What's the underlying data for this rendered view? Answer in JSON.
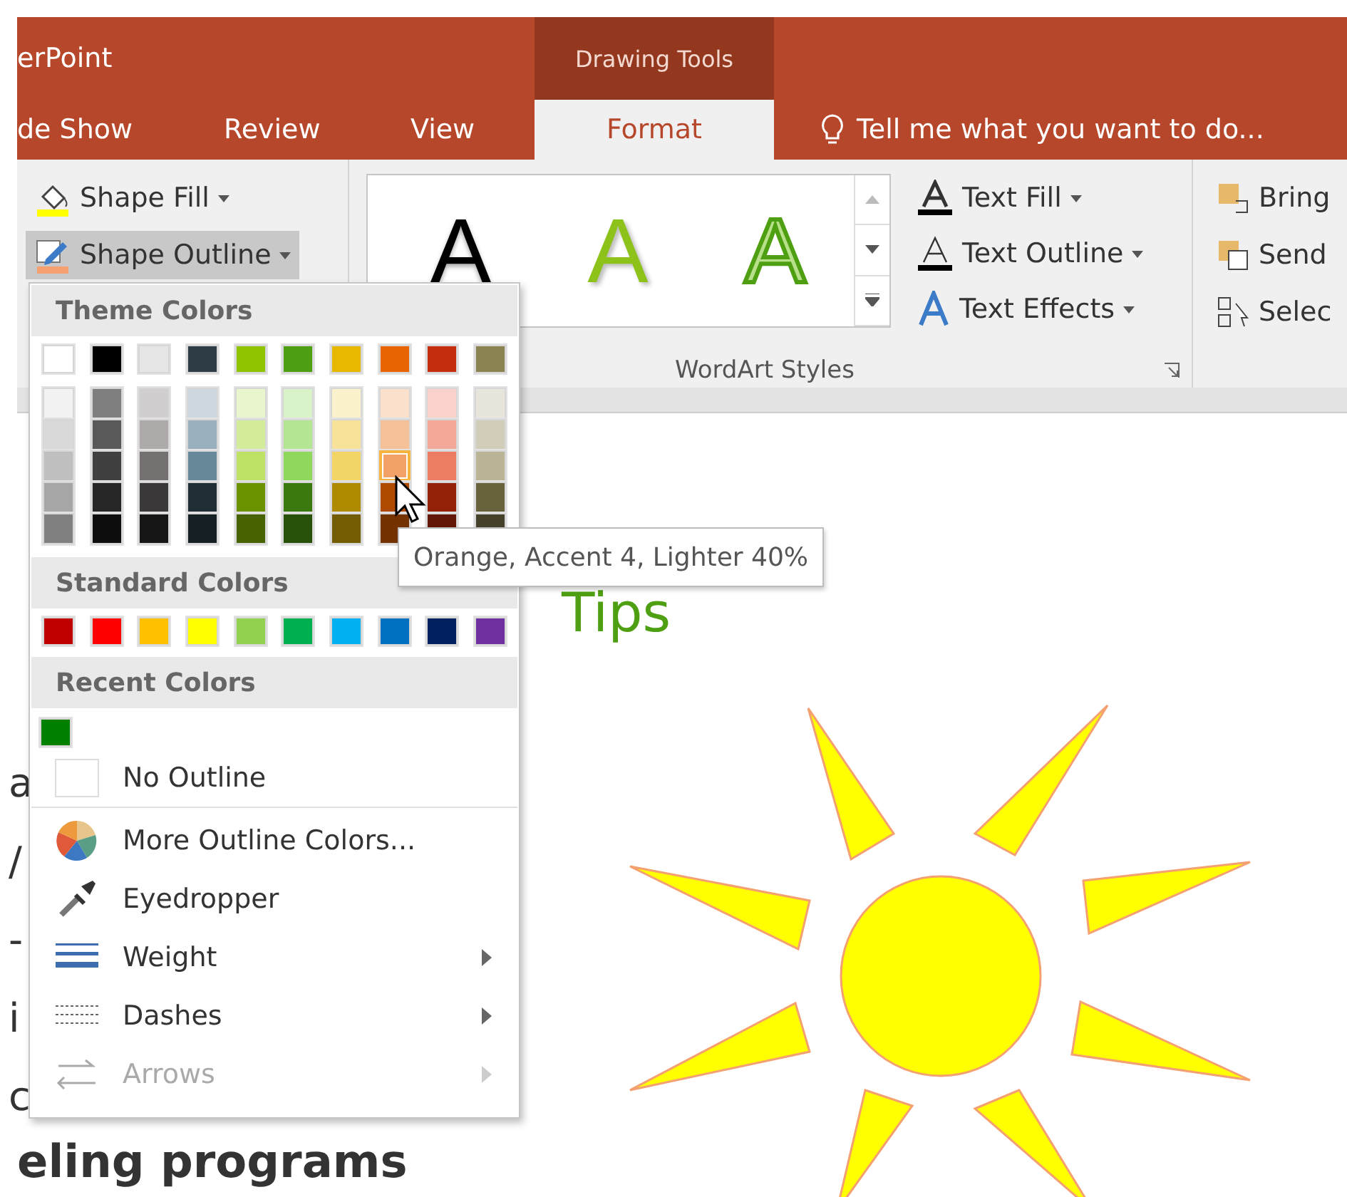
{
  "window": {
    "title": "erPoint",
    "context_tab": "Drawing Tools"
  },
  "tabs": [
    {
      "label": "de Show",
      "selected": false
    },
    {
      "label": "Review",
      "selected": false
    },
    {
      "label": "View",
      "selected": false
    },
    {
      "label": "Format",
      "selected": true
    }
  ],
  "tell_me": {
    "placeholder": "Tell me what you want to do..."
  },
  "ribbon": {
    "shape_buttons": [
      {
        "kind": "fill",
        "label": "Shape Fill",
        "selected": false
      },
      {
        "kind": "outline",
        "label": "Shape Outline",
        "selected": true
      }
    ],
    "wordart_gallery": [
      {
        "kind": "plain",
        "letter": "A"
      },
      {
        "kind": "shadow",
        "letter": "A"
      },
      {
        "kind": "outline",
        "letter": "A"
      }
    ],
    "text_buttons": [
      {
        "kind": "fill",
        "label": "Text Fill"
      },
      {
        "kind": "outline",
        "label": "Text Outline"
      },
      {
        "kind": "effects",
        "label": "Text Effects"
      }
    ],
    "group_label": "WordArt Styles",
    "arrange_buttons": [
      {
        "kind": "bring",
        "label": "Bring"
      },
      {
        "kind": "send",
        "label": "Send"
      },
      {
        "kind": "select",
        "label": "Selec"
      }
    ]
  },
  "menu": {
    "theme_header": "Theme Colors",
    "theme_colors": [
      {
        "color": "#ffffff",
        "shades": [
          {
            "color": "#f2f2f2",
            "selected": false
          },
          {
            "color": "#d9d9d9",
            "selected": false
          },
          {
            "color": "#bfbfbf",
            "selected": false
          },
          {
            "color": "#a6a6a6",
            "selected": false
          },
          {
            "color": "#808080",
            "selected": false
          }
        ]
      },
      {
        "color": "#000000",
        "shades": [
          {
            "color": "#7f7f7f",
            "selected": false
          },
          {
            "color": "#595959",
            "selected": false
          },
          {
            "color": "#404040",
            "selected": false
          },
          {
            "color": "#262626",
            "selected": false
          },
          {
            "color": "#0d0d0d",
            "selected": false
          }
        ]
      },
      {
        "color": "#e7e6e6",
        "shades": [
          {
            "color": "#d0cece",
            "selected": false
          },
          {
            "color": "#aeaaaa",
            "selected": false
          },
          {
            "color": "#757171",
            "selected": false
          },
          {
            "color": "#3a3838",
            "selected": false
          },
          {
            "color": "#161616",
            "selected": false
          }
        ]
      },
      {
        "color": "#2e3d45",
        "shades": [
          {
            "color": "#ccd7de",
            "selected": false
          },
          {
            "color": "#99afbd",
            "selected": false
          },
          {
            "color": "#678898",
            "selected": false
          },
          {
            "color": "#222e36",
            "selected": false
          },
          {
            "color": "#161f24",
            "selected": false
          }
        ]
      },
      {
        "color": "#90c400",
        "shades": [
          {
            "color": "#e9f5cc",
            "selected": false
          },
          {
            "color": "#d3ec99",
            "selected": false
          },
          {
            "color": "#bde266",
            "selected": false
          },
          {
            "color": "#6b9300",
            "selected": false
          },
          {
            "color": "#476200",
            "selected": false
          }
        ]
      },
      {
        "color": "#4ea012",
        "shades": [
          {
            "color": "#d9f2c8",
            "selected": false
          },
          {
            "color": "#b4e592",
            "selected": false
          },
          {
            "color": "#8fd85b",
            "selected": false
          },
          {
            "color": "#3b780e",
            "selected": false
          },
          {
            "color": "#275009",
            "selected": false
          }
        ]
      },
      {
        "color": "#e8b800",
        "shades": [
          {
            "color": "#fbf1cc",
            "selected": false
          },
          {
            "color": "#f6e399",
            "selected": false
          },
          {
            "color": "#f2d566",
            "selected": false
          },
          {
            "color": "#ae8a00",
            "selected": false
          },
          {
            "color": "#745c00",
            "selected": false
          }
        ]
      },
      {
        "color": "#e86400",
        "shades": [
          {
            "color": "#fbe0cc",
            "selected": false
          },
          {
            "color": "#f6c199",
            "selected": false
          },
          {
            "color": "#f2a266",
            "selected": true
          },
          {
            "color": "#ae4b00",
            "selected": false
          },
          {
            "color": "#743200",
            "selected": false
          }
        ]
      },
      {
        "color": "#c62d0e",
        "shades": [
          {
            "color": "#f9d3cb",
            "selected": false
          },
          {
            "color": "#f2a897",
            "selected": false
          },
          {
            "color": "#ec7c63",
            "selected": false
          },
          {
            "color": "#94220a",
            "selected": false
          },
          {
            "color": "#631707",
            "selected": false
          }
        ]
      },
      {
        "color": "#8b8352",
        "shades": [
          {
            "color": "#e8e6dc",
            "selected": false
          },
          {
            "color": "#d1cdb9",
            "selected": false
          },
          {
            "color": "#bab497",
            "selected": false
          },
          {
            "color": "#68623d",
            "selected": false
          },
          {
            "color": "#46412a",
            "selected": false
          }
        ]
      }
    ],
    "standard_header": "Standard Colors",
    "standard_colors": [
      {
        "color": "#c00000"
      },
      {
        "color": "#ff0000"
      },
      {
        "color": "#ffc000"
      },
      {
        "color": "#ffff00"
      },
      {
        "color": "#92d050"
      },
      {
        "color": "#00b050"
      },
      {
        "color": "#00b0f0"
      },
      {
        "color": "#0070c0"
      },
      {
        "color": "#002060"
      },
      {
        "color": "#7030a0"
      }
    ],
    "recent_header": "Recent Colors",
    "recent_colors": [
      {
        "color": "#008000"
      }
    ],
    "items": [
      {
        "kind": "no-outline",
        "label": "No Outline",
        "has_submenu": false,
        "disabled": false
      },
      {
        "kind": "more-colors",
        "label": "More Outline Colors...",
        "has_submenu": false,
        "disabled": false
      },
      {
        "kind": "eyedropper",
        "label": "Eyedropper",
        "has_submenu": false,
        "disabled": false
      },
      {
        "kind": "weight",
        "label": "Weight",
        "has_submenu": true,
        "disabled": false
      },
      {
        "kind": "dashes",
        "label": "Dashes",
        "has_submenu": true,
        "disabled": false
      },
      {
        "kind": "arrows",
        "label": "Arrows",
        "has_submenu": true,
        "disabled": true
      }
    ]
  },
  "tooltip": "Orange, Accent 4, Lighter 40%",
  "slide": {
    "title": "Tips",
    "edge_letters": [
      "a",
      "/",
      "-",
      "i",
      "c"
    ],
    "body_line": "eling programs"
  }
}
